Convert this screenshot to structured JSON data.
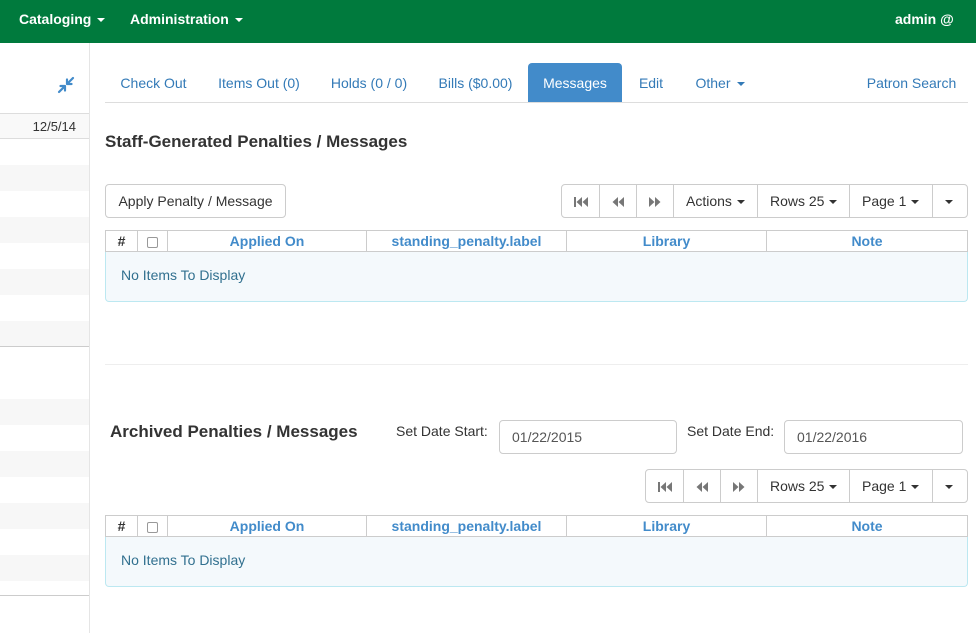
{
  "navbar": {
    "menus": [
      "Cataloging",
      "Administration"
    ],
    "user": "admin @"
  },
  "sidebar": {
    "date": "12/5/14"
  },
  "tabs": [
    {
      "label": "Check Out"
    },
    {
      "label": "Items Out (0)"
    },
    {
      "label": "Holds (0 / 0)"
    },
    {
      "label": "Bills ($0.00)"
    },
    {
      "label": "Messages",
      "active": true
    },
    {
      "label": "Edit"
    },
    {
      "label": "Other"
    }
  ],
  "patron_search": "Patron Search",
  "staff_section": {
    "title": "Staff-Generated Penalties / Messages",
    "apply_button": "Apply Penalty / Message",
    "actions": "Actions",
    "rows": "Rows 25",
    "page": "Page 1",
    "columns": {
      "num": "#",
      "applied_on": "Applied On",
      "label": "standing_penalty.label",
      "library": "Library",
      "note": "Note"
    },
    "empty": "No Items To Display"
  },
  "archived_section": {
    "title": "Archived Penalties / Messages",
    "date_start_label": "Set Date Start:",
    "date_start": "01/22/2015",
    "date_end_label": "Set Date End:",
    "date_end": "01/22/2016",
    "rows": "Rows 25",
    "page": "Page 1",
    "columns": {
      "num": "#",
      "applied_on": "Applied On",
      "label": "standing_penalty.label",
      "library": "Library",
      "note": "Note"
    },
    "empty": "No Items To Display"
  },
  "colors": {
    "navbar": "#007a3d",
    "link": "#337ab7",
    "active_tab": "#428bca",
    "info_text": "#31708f"
  }
}
